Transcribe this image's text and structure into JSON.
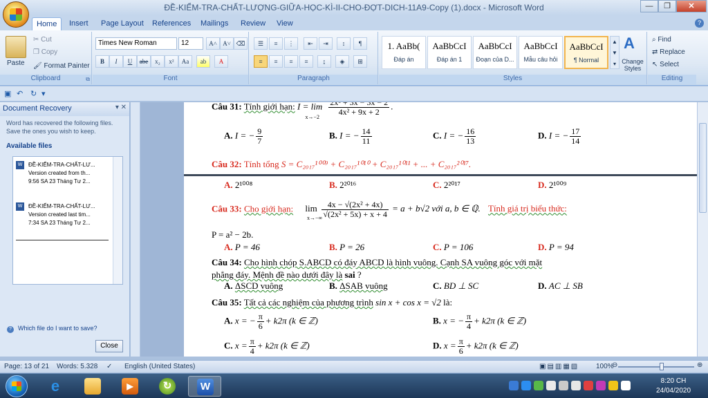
{
  "window": {
    "title": "ĐỀ-KIỂM-TRA-CHẤT-LƯỢNG-GIỮA-HỌC-KÌ-II-CHO-ĐỢT-DICH-11A9-Copy (1).docx - Microsoft Word",
    "minimize": "—",
    "maximize": "❐",
    "close": "✕"
  },
  "tabs": [
    "Home",
    "Insert",
    "Page Layout",
    "References",
    "Mailings",
    "Review",
    "View"
  ],
  "clipboard": {
    "paste": "Paste",
    "cut": "Cut",
    "copy": "Copy",
    "format_painter": "Format Painter",
    "label": "Clipboard"
  },
  "font": {
    "name": "Times New Roman",
    "size": "12",
    "label": "Font"
  },
  "paragraph": {
    "label": "Paragraph"
  },
  "styles": {
    "items": [
      {
        "sample": "1. AaBb(",
        "name": "Đáp án"
      },
      {
        "sample": "AaBbCcI",
        "name": "Đáp án 1"
      },
      {
        "sample": "AaBbCcI",
        "name": "Đoạn của D..."
      },
      {
        "sample": "AaBbCcI",
        "name": "Mẫu câu hỏi"
      },
      {
        "sample": "AaBbCcI",
        "name": "¶ Normal"
      }
    ],
    "change_styles": "Change Styles",
    "label": "Styles"
  },
  "editing": {
    "find": "Find",
    "replace": "Replace",
    "select": "Select",
    "label": "Editing"
  },
  "recovery": {
    "title": "Document Recovery",
    "description": "Word has recovered the following files. Save the ones you wish to keep.",
    "available": "Available files",
    "files": [
      {
        "name": "ĐỀ-KIỂM-TRA-CHẤT-LƯ...",
        "version": "Version created from th...",
        "time": "9:56 SA 23 Tháng Tư 2..."
      },
      {
        "name": "ĐỀ-KIỂM-TRA-CHẤT-LƯ...",
        "version": "Version created last tim...",
        "time": "7:34 SA 23 Tháng Tư 2..."
      }
    ],
    "help": "Which file do I want to save?",
    "close": "Close"
  },
  "document": {
    "q31": {
      "label": "Câu 31:",
      "text": "Tính giới hạn:",
      "expr": "I = lim",
      "sub": "x→−2",
      "num": "2x² + 3x − 3x − 2",
      "den": "4x² + 9x + 2"
    },
    "q31_answers": [
      {
        "letter": "A.",
        "expr": "I = −",
        "num": "9",
        "den": "7"
      },
      {
        "letter": "B.",
        "expr": "I = −",
        "num": "14",
        "den": "11"
      },
      {
        "letter": "C.",
        "expr": "I = −",
        "num": "16",
        "den": "13"
      },
      {
        "letter": "D.",
        "expr": "I = −",
        "num": "17",
        "den": "14"
      }
    ],
    "q32": {
      "label": "Câu 32:",
      "text": "Tính tổng",
      "expr": "S = C₂₀₁₇¹⁰⁰⁹ + C₂₀₁₇¹⁰¹⁰ + C₂₀₁₇¹⁰¹¹ + ... + C₂₀₁₇²⁰¹⁷."
    },
    "q32_answers": [
      {
        "letter": "A.",
        "expr": "2¹⁰⁰⁸"
      },
      {
        "letter": "B.",
        "expr": "2²⁰¹⁶"
      },
      {
        "letter": "C.",
        "expr": "2²⁰¹⁷"
      },
      {
        "letter": "D.",
        "expr": "2¹⁰⁰⁹"
      }
    ],
    "q33": {
      "label": "Câu 33:",
      "text": "Cho giới hạn:",
      "lim": "lim",
      "sub": "x→−∞",
      "num": "4x − √(2x² + 4x)",
      "den": "√(2x² + 5x) + x + 4",
      "rhs": "= a + b√2  với  a, b ∈ ℚ.",
      "tail": "Tính giá trị biểu thức:",
      "line2": "P = a² − 2b."
    },
    "q33_answers": [
      {
        "letter": "A.",
        "expr": "P = 46"
      },
      {
        "letter": "B.",
        "expr": "P = 26"
      },
      {
        "letter": "C.",
        "expr": "P = 106"
      },
      {
        "letter": "D.",
        "expr": "P = 94"
      }
    ],
    "q34": {
      "label": "Câu 34:",
      "line1": "Cho hình chóp S.ABCD có đáy ABCD là hình vuông. Cạnh SA vuông góc với mặt",
      "line2_pre": "phẳng đáy. Mệnh đề nào dưới đây là",
      "line2_bold": "sai",
      "line2_post": "?"
    },
    "q34_answers": [
      {
        "letter": "A.",
        "expr": "ΔSCD vuông"
      },
      {
        "letter": "B.",
        "expr": "ΔSAB vuông"
      },
      {
        "letter": "C.",
        "expr": "BD ⊥ SC"
      },
      {
        "letter": "D.",
        "expr": "AC ⊥ SB"
      }
    ],
    "q35": {
      "label": "Câu 35:",
      "text": "Tất cả các nghiệm của phương trình",
      "expr": "sin x + cos x = √2",
      "tail": "là:"
    },
    "q35_answers": [
      {
        "letter": "A.",
        "pre": "x = −",
        "num": "π",
        "den": "6",
        "post": "+ k2π   (k ∈ ℤ)"
      },
      {
        "letter": "B.",
        "pre": "x = −",
        "num": "π",
        "den": "4",
        "post": "+ k2π   (k ∈ ℤ)"
      },
      {
        "letter": "C.",
        "pre": "x =",
        "num": "π",
        "den": "4",
        "post": "+ k2π   (k ∈ ℤ)"
      },
      {
        "letter": "D.",
        "pre": "x =",
        "num": "π",
        "den": "6",
        "post": "+ k2π   (k ∈ ℤ)"
      }
    ]
  },
  "status": {
    "page": "Page: 13 of 21",
    "words": "Words: 5.328",
    "language": "English (United States)",
    "zoom": "100%"
  },
  "clock": {
    "time": "8:20 CH",
    "date": "24/04/2020"
  }
}
